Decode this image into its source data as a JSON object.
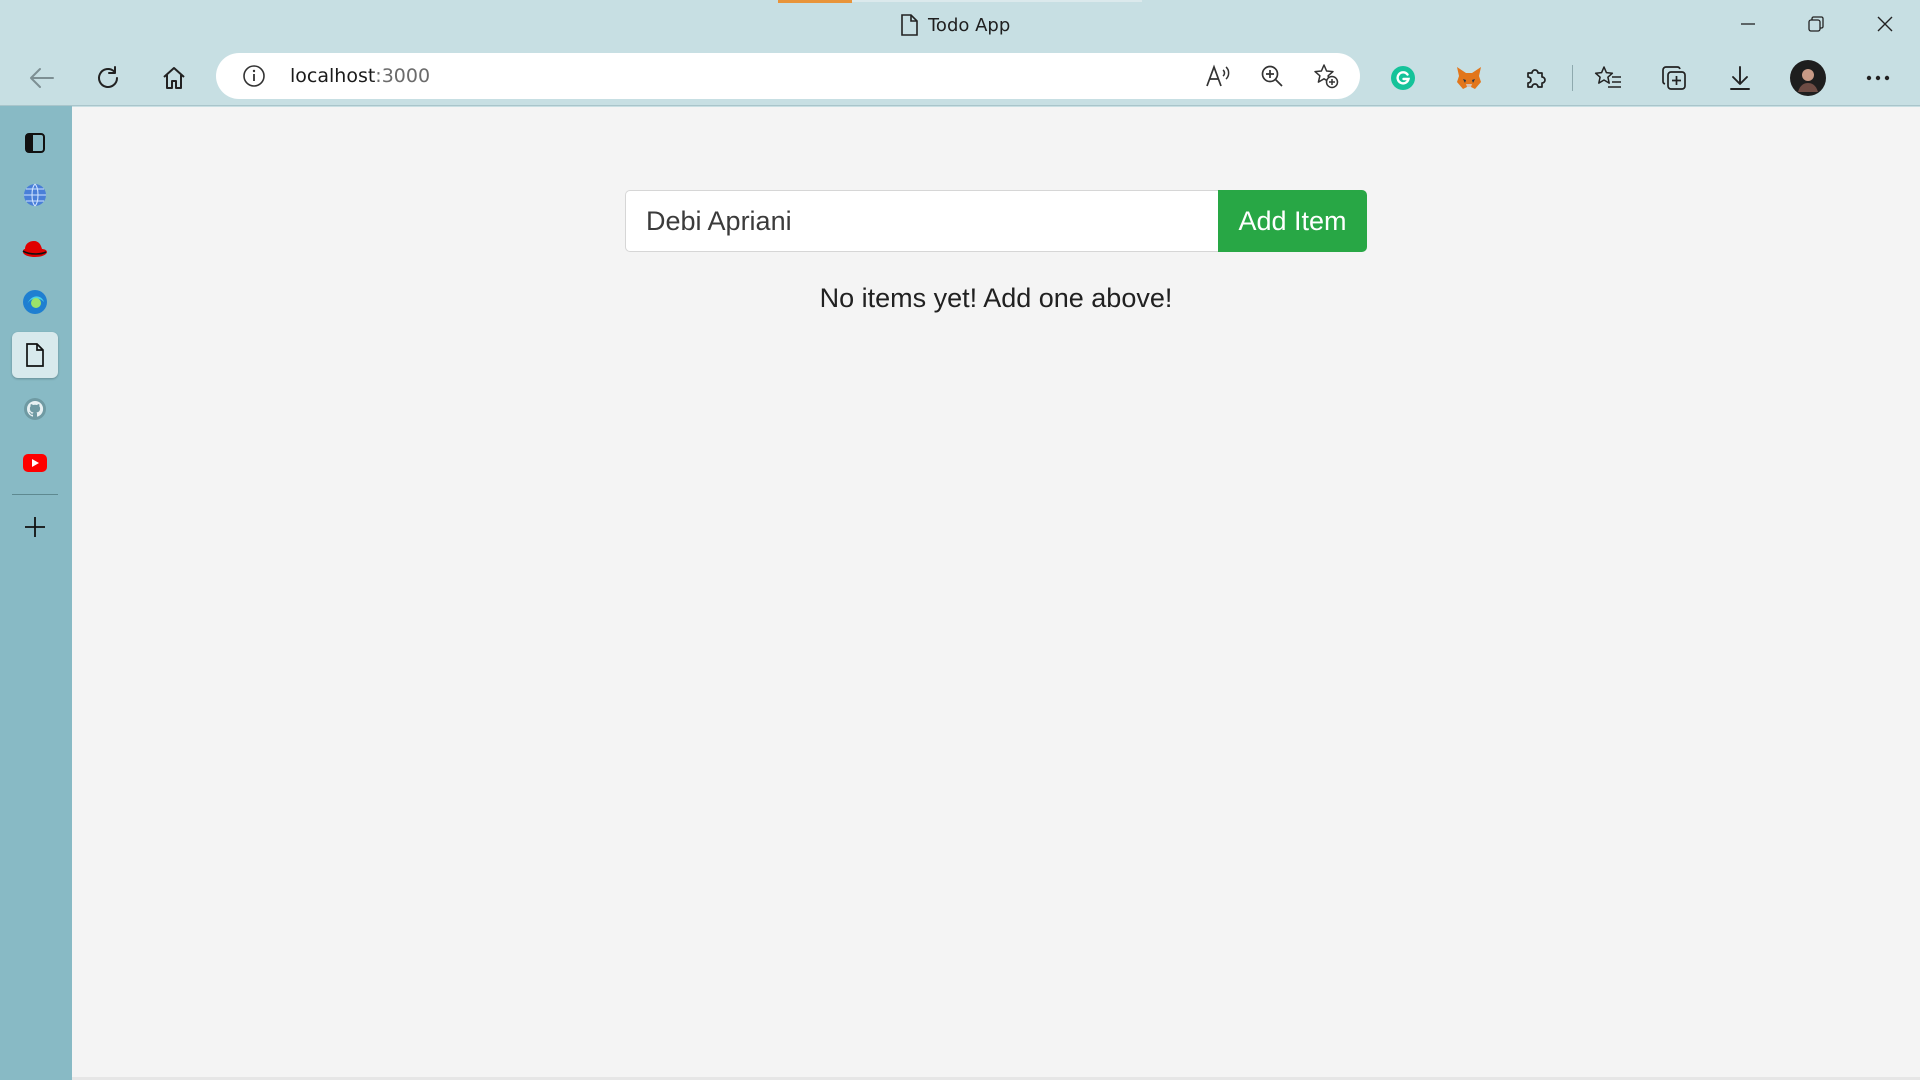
{
  "window": {
    "title": "Todo App"
  },
  "colors": {
    "accent": "#28a745",
    "tab_indicator": "#e8943a",
    "sidebar": "#88bac5",
    "chrome": "#c7dfe3"
  },
  "address_bar": {
    "host": "localhost",
    "port": ":3000"
  },
  "toolbar_icons": [
    "back-icon",
    "refresh-icon",
    "home-icon",
    "site-info-icon",
    "read-aloud-icon",
    "zoom-icon",
    "add-favorite-icon",
    "grammarly-icon",
    "metamask-icon",
    "extensions-icon",
    "favorites-icon",
    "collections-icon",
    "downloads-icon",
    "profile-avatar",
    "more-icon"
  ],
  "sidebar_icons": [
    "tab-actions-icon",
    "globe-icon",
    "red-hat-icon",
    "browser-icon",
    "document-icon",
    "github-icon",
    "youtube-icon",
    "add-icon"
  ],
  "todo": {
    "input_value": "Debi Apriani",
    "add_button": "Add Item",
    "empty_message": "No items yet! Add one above!"
  }
}
